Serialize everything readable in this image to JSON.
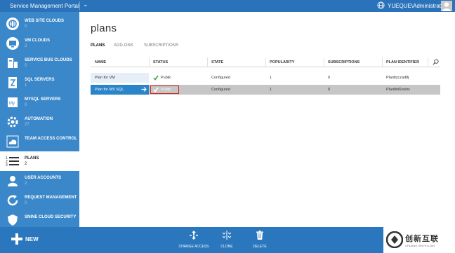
{
  "topbar": {
    "portal_title": "Service Management Portal",
    "user": "YUEQUE\\Administrator"
  },
  "sidebar": {
    "items": [
      {
        "label": "WEB SITE CLOUDS",
        "count": "0",
        "icon": "globe-cloud-icon"
      },
      {
        "label": "VM CLOUDS",
        "count": "2",
        "icon": "vm-icon"
      },
      {
        "label": "SERVICE BUS CLOUDS",
        "count": "0",
        "icon": "service-bus-icon"
      },
      {
        "label": "SQL SERVERS",
        "count": "1",
        "icon": "sql-server-icon"
      },
      {
        "label": "MYSQL SERVERS",
        "count": "0",
        "icon": "mysql-icon"
      },
      {
        "label": "AUTOMATION",
        "count": "27",
        "icon": "automation-gear-icon"
      },
      {
        "label": "TEAM ACCESS CONTROL",
        "count": "",
        "icon": "cloud-icon"
      },
      {
        "label": "PLANS",
        "count": "2",
        "icon": "list-icon"
      },
      {
        "label": "USER ACCOUNTS",
        "count": "2",
        "icon": "user-icon"
      },
      {
        "label": "REQUEST MANAGEMENT",
        "count": "0",
        "icon": "refresh-icon"
      },
      {
        "label": "SNINE CLOUD SECURITY",
        "count": "",
        "icon": "shield-icon"
      }
    ]
  },
  "main": {
    "title": "plans",
    "tabs": [
      "PLANS",
      "ADD-ONS",
      "SUBSCRIPTIONS"
    ],
    "columns": [
      "NAME",
      "STATUS",
      "STATE",
      "POPULARITY",
      "SUBSCRIPTIONS",
      "PLAN IDENTIFIER"
    ],
    "rows": [
      {
        "name": "Plan for VM",
        "status": "Public",
        "state": "Configured",
        "popularity": "1",
        "subscriptions": "0",
        "identifier": "Planfizczad8j"
      },
      {
        "name": "Plan for MS SQL",
        "status": "Public",
        "state": "Configured",
        "popularity": "1",
        "subscriptions": "0",
        "identifier": "Plan8nl6zwhs"
      }
    ]
  },
  "bottombar": {
    "new_label": "NEW",
    "commands": [
      {
        "label": "CHANGE ACCESS",
        "icon": "change-access-icon"
      },
      {
        "label": "CLONE",
        "icon": "clone-icon"
      },
      {
        "label": "DELETE",
        "icon": "trash-icon"
      }
    ]
  },
  "watermark": {
    "brand_cn": "创新互联",
    "brand_en": "CHUANG XIN HU LIAN"
  },
  "colors": {
    "topbar": "#2a72ba",
    "sidebar": "#3a87c9",
    "selected_row": "#c6c6c6",
    "highlight_box": "#d32020",
    "check_green": "#3aa845"
  }
}
